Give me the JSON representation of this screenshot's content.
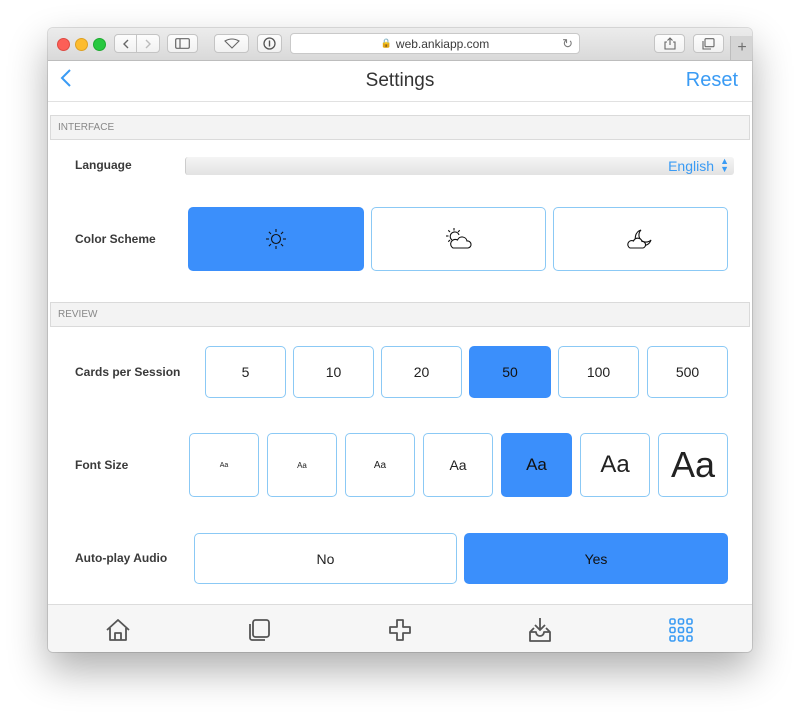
{
  "browser": {
    "url": "web.ankiapp.com"
  },
  "header": {
    "title": "Settings",
    "reset_label": "Reset",
    "back_icon": "chevron-left-icon"
  },
  "interface": {
    "section_label": "INTERFACE",
    "language_label": "Language",
    "language_value": "English",
    "color_scheme_label": "Color Scheme",
    "color_scheme_options": [
      "light-sun-icon",
      "auto-sun-cloud-icon",
      "dark-moon-cloud-icon"
    ],
    "color_scheme_selected": 0
  },
  "review": {
    "section_label": "REVIEW",
    "cards_label": "Cards per Session",
    "cards_options": [
      "5",
      "10",
      "20",
      "50",
      "100",
      "500"
    ],
    "cards_selected": "50",
    "font_size_label": "Font Size",
    "font_size_sample": "Aa",
    "font_size_selected_index": 4,
    "autoplay_label": "Auto-play Audio",
    "autoplay_no": "No",
    "autoplay_yes": "Yes",
    "autoplay_selected": "Yes"
  },
  "tabs": [
    "home-icon",
    "cards-icon",
    "add-icon",
    "inbox-download-icon",
    "grid-menu-icon"
  ],
  "colors": {
    "accent": "#3a9bf4",
    "selected_fill": "#3b8ffb",
    "option_border": "#8bc9f5"
  }
}
